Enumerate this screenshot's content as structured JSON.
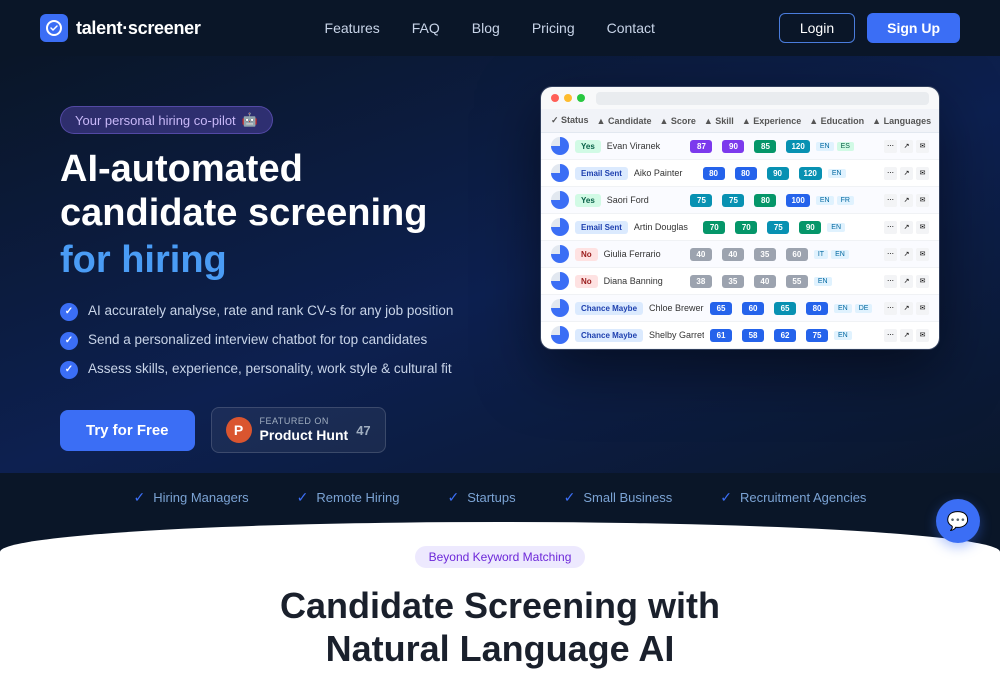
{
  "navbar": {
    "logo_text": "talent·screener",
    "nav_links": [
      {
        "label": "Features",
        "id": "features"
      },
      {
        "label": "FAQ",
        "id": "faq"
      },
      {
        "label": "Blog",
        "id": "blog"
      },
      {
        "label": "Pricing",
        "id": "pricing"
      },
      {
        "label": "Contact",
        "id": "contact"
      }
    ],
    "login_label": "Login",
    "signup_label": "Sign Up"
  },
  "hero": {
    "badge_text": "Your personal hiring co-pilot",
    "badge_emoji": "🤖",
    "title_line1": "AI-automated",
    "title_line2": "candidate screening",
    "title_line3": "for hiring",
    "features": [
      "AI accurately analyse, rate and rank CV-s for any job position",
      "Send a personalized interview chatbot for top candidates",
      "Assess skills, experience, personality, work style &  cultural fit"
    ],
    "cta_button": "Try for Free",
    "product_hunt": {
      "featured_label": "FEATURED ON",
      "name": "Product Hunt",
      "count": "47"
    }
  },
  "trust_bar": {
    "items": [
      "Hiring Managers",
      "Remote Hiring",
      "Startups",
      "Small Business",
      "Recruitment Agencies"
    ]
  },
  "bottom": {
    "badge": "Beyond Keyword Matching",
    "title_line1": "Candidate Screening with",
    "title_line2": "Natural Language AI"
  },
  "dashboard": {
    "headers": [
      "Status",
      "Candidate",
      "Score",
      "Skill",
      "Experience",
      "Education",
      "Languages"
    ],
    "rows": [
      {
        "status": "Yes",
        "status_type": "yes",
        "name": "Evan Viranek",
        "score": "87",
        "score_type": "purple",
        "skill": "90",
        "exp": "85",
        "edu": "120",
        "langs": [
          "EN",
          "ES"
        ],
        "spinner": true
      },
      {
        "status": "Email Sent",
        "status_type": "email",
        "name": "Aiko Painter",
        "score": "80",
        "score_type": "blue",
        "skill": "80",
        "exp": "90",
        "edu": "120",
        "langs": [
          "EN"
        ],
        "spinner": true
      },
      {
        "status": "Yes",
        "status_type": "yes",
        "name": "Saori Ford",
        "score": "75",
        "score_type": "teal",
        "skill": "75",
        "exp": "80",
        "edu": "100",
        "langs": [
          "EN",
          "FR"
        ],
        "spinner": true
      },
      {
        "status": "Email Sent",
        "status_type": "email",
        "name": "Artin Douglas",
        "score": "70",
        "score_type": "green",
        "skill": "70",
        "exp": "75",
        "edu": "90",
        "langs": [
          "EN"
        ],
        "spinner": true
      },
      {
        "status": "No",
        "status_type": "no",
        "name": "Giulia Ferrario",
        "score": "40",
        "score_type": "gray",
        "skill": "40",
        "exp": "35",
        "edu": "60",
        "langs": [
          "IT",
          "EN"
        ],
        "spinner": true
      },
      {
        "status": "No",
        "status_type": "no",
        "name": "Diana Banning",
        "score": "38",
        "score_type": "gray",
        "skill": "35",
        "exp": "40",
        "edu": "55",
        "langs": [
          "EN"
        ],
        "spinner": true
      },
      {
        "status": "Chance Maybe",
        "status_type": "email",
        "name": "Chloe Brewer",
        "score": "65",
        "score_type": "blue",
        "skill": "60",
        "exp": "65",
        "edu": "80",
        "langs": [
          "EN",
          "DE"
        ],
        "spinner": true
      },
      {
        "status": "Chance Maybe",
        "status_type": "email",
        "name": "Shelby Garrett",
        "score": "61",
        "score_type": "blue",
        "skill": "58",
        "exp": "62",
        "edu": "75",
        "langs": [
          "EN"
        ],
        "spinner": true
      }
    ]
  }
}
